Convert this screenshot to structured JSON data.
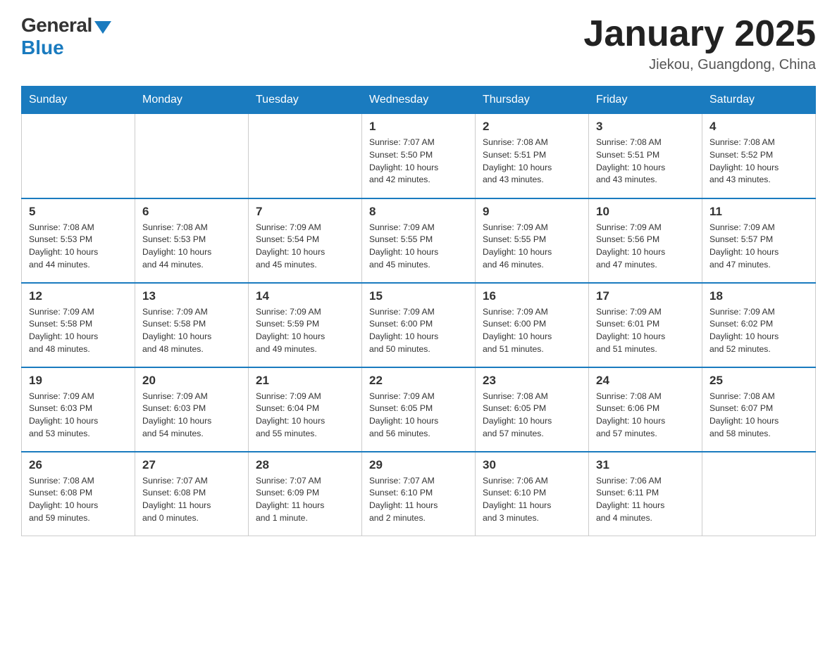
{
  "header": {
    "logo_general": "General",
    "logo_blue": "Blue",
    "title": "January 2025",
    "location": "Jiekou, Guangdong, China"
  },
  "weekdays": [
    "Sunday",
    "Monday",
    "Tuesday",
    "Wednesday",
    "Thursday",
    "Friday",
    "Saturday"
  ],
  "weeks": [
    [
      {
        "day": "",
        "info": ""
      },
      {
        "day": "",
        "info": ""
      },
      {
        "day": "",
        "info": ""
      },
      {
        "day": "1",
        "info": "Sunrise: 7:07 AM\nSunset: 5:50 PM\nDaylight: 10 hours\nand 42 minutes."
      },
      {
        "day": "2",
        "info": "Sunrise: 7:08 AM\nSunset: 5:51 PM\nDaylight: 10 hours\nand 43 minutes."
      },
      {
        "day": "3",
        "info": "Sunrise: 7:08 AM\nSunset: 5:51 PM\nDaylight: 10 hours\nand 43 minutes."
      },
      {
        "day": "4",
        "info": "Sunrise: 7:08 AM\nSunset: 5:52 PM\nDaylight: 10 hours\nand 43 minutes."
      }
    ],
    [
      {
        "day": "5",
        "info": "Sunrise: 7:08 AM\nSunset: 5:53 PM\nDaylight: 10 hours\nand 44 minutes."
      },
      {
        "day": "6",
        "info": "Sunrise: 7:08 AM\nSunset: 5:53 PM\nDaylight: 10 hours\nand 44 minutes."
      },
      {
        "day": "7",
        "info": "Sunrise: 7:09 AM\nSunset: 5:54 PM\nDaylight: 10 hours\nand 45 minutes."
      },
      {
        "day": "8",
        "info": "Sunrise: 7:09 AM\nSunset: 5:55 PM\nDaylight: 10 hours\nand 45 minutes."
      },
      {
        "day": "9",
        "info": "Sunrise: 7:09 AM\nSunset: 5:55 PM\nDaylight: 10 hours\nand 46 minutes."
      },
      {
        "day": "10",
        "info": "Sunrise: 7:09 AM\nSunset: 5:56 PM\nDaylight: 10 hours\nand 47 minutes."
      },
      {
        "day": "11",
        "info": "Sunrise: 7:09 AM\nSunset: 5:57 PM\nDaylight: 10 hours\nand 47 minutes."
      }
    ],
    [
      {
        "day": "12",
        "info": "Sunrise: 7:09 AM\nSunset: 5:58 PM\nDaylight: 10 hours\nand 48 minutes."
      },
      {
        "day": "13",
        "info": "Sunrise: 7:09 AM\nSunset: 5:58 PM\nDaylight: 10 hours\nand 48 minutes."
      },
      {
        "day": "14",
        "info": "Sunrise: 7:09 AM\nSunset: 5:59 PM\nDaylight: 10 hours\nand 49 minutes."
      },
      {
        "day": "15",
        "info": "Sunrise: 7:09 AM\nSunset: 6:00 PM\nDaylight: 10 hours\nand 50 minutes."
      },
      {
        "day": "16",
        "info": "Sunrise: 7:09 AM\nSunset: 6:00 PM\nDaylight: 10 hours\nand 51 minutes."
      },
      {
        "day": "17",
        "info": "Sunrise: 7:09 AM\nSunset: 6:01 PM\nDaylight: 10 hours\nand 51 minutes."
      },
      {
        "day": "18",
        "info": "Sunrise: 7:09 AM\nSunset: 6:02 PM\nDaylight: 10 hours\nand 52 minutes."
      }
    ],
    [
      {
        "day": "19",
        "info": "Sunrise: 7:09 AM\nSunset: 6:03 PM\nDaylight: 10 hours\nand 53 minutes."
      },
      {
        "day": "20",
        "info": "Sunrise: 7:09 AM\nSunset: 6:03 PM\nDaylight: 10 hours\nand 54 minutes."
      },
      {
        "day": "21",
        "info": "Sunrise: 7:09 AM\nSunset: 6:04 PM\nDaylight: 10 hours\nand 55 minutes."
      },
      {
        "day": "22",
        "info": "Sunrise: 7:09 AM\nSunset: 6:05 PM\nDaylight: 10 hours\nand 56 minutes."
      },
      {
        "day": "23",
        "info": "Sunrise: 7:08 AM\nSunset: 6:05 PM\nDaylight: 10 hours\nand 57 minutes."
      },
      {
        "day": "24",
        "info": "Sunrise: 7:08 AM\nSunset: 6:06 PM\nDaylight: 10 hours\nand 57 minutes."
      },
      {
        "day": "25",
        "info": "Sunrise: 7:08 AM\nSunset: 6:07 PM\nDaylight: 10 hours\nand 58 minutes."
      }
    ],
    [
      {
        "day": "26",
        "info": "Sunrise: 7:08 AM\nSunset: 6:08 PM\nDaylight: 10 hours\nand 59 minutes."
      },
      {
        "day": "27",
        "info": "Sunrise: 7:07 AM\nSunset: 6:08 PM\nDaylight: 11 hours\nand 0 minutes."
      },
      {
        "day": "28",
        "info": "Sunrise: 7:07 AM\nSunset: 6:09 PM\nDaylight: 11 hours\nand 1 minute."
      },
      {
        "day": "29",
        "info": "Sunrise: 7:07 AM\nSunset: 6:10 PM\nDaylight: 11 hours\nand 2 minutes."
      },
      {
        "day": "30",
        "info": "Sunrise: 7:06 AM\nSunset: 6:10 PM\nDaylight: 11 hours\nand 3 minutes."
      },
      {
        "day": "31",
        "info": "Sunrise: 7:06 AM\nSunset: 6:11 PM\nDaylight: 11 hours\nand 4 minutes."
      },
      {
        "day": "",
        "info": ""
      }
    ]
  ]
}
